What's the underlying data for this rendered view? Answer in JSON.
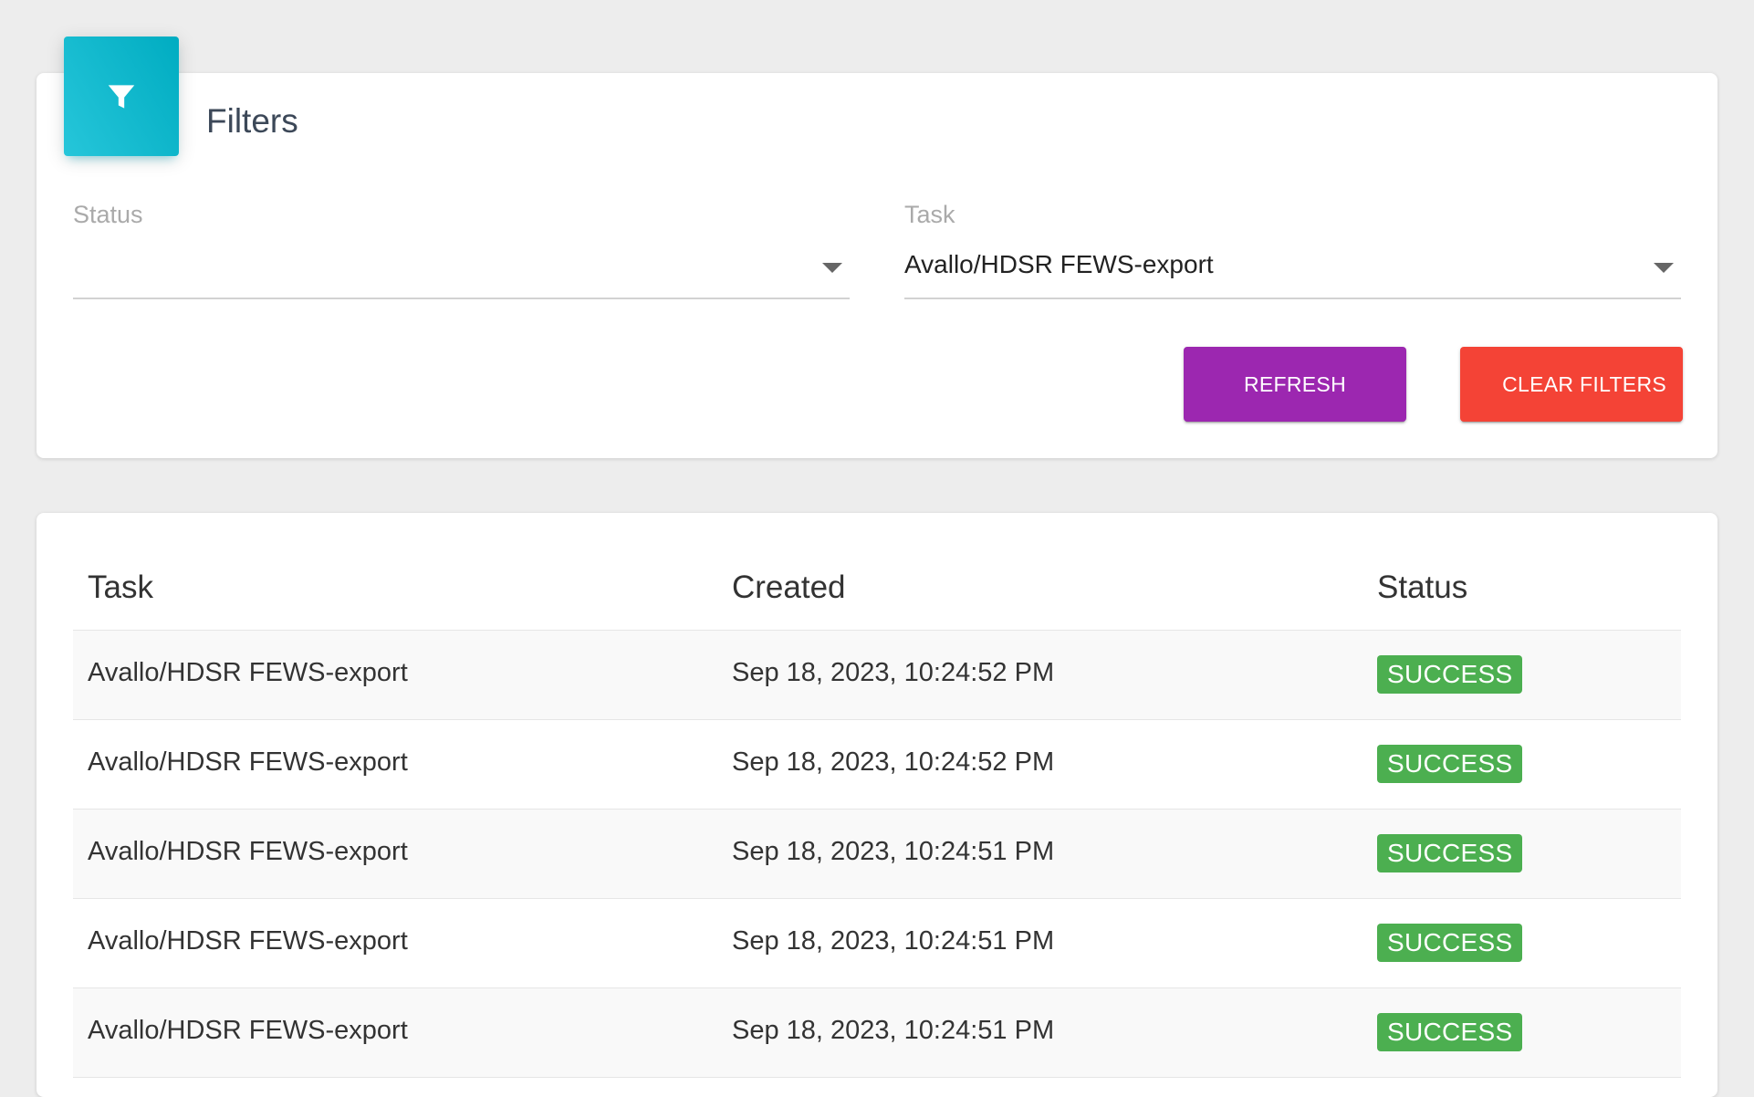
{
  "filters": {
    "title": "Filters",
    "icon": "filter-icon",
    "status_label": "Status",
    "status_value": "",
    "task_label": "Task",
    "task_value": "Avallo/HDSR FEWS-export",
    "refresh_label": "REFRESH",
    "clear_label": "CLEAR FILTERS"
  },
  "table": {
    "headers": {
      "task": "Task",
      "created": "Created",
      "status": "Status"
    },
    "rows": [
      {
        "task": "Avallo/HDSR FEWS-export",
        "created": "Sep 18, 2023, 10:24:52 PM",
        "status": "SUCCESS"
      },
      {
        "task": "Avallo/HDSR FEWS-export",
        "created": "Sep 18, 2023, 10:24:52 PM",
        "status": "SUCCESS"
      },
      {
        "task": "Avallo/HDSR FEWS-export",
        "created": "Sep 18, 2023, 10:24:51 PM",
        "status": "SUCCESS"
      },
      {
        "task": "Avallo/HDSR FEWS-export",
        "created": "Sep 18, 2023, 10:24:51 PM",
        "status": "SUCCESS"
      },
      {
        "task": "Avallo/HDSR FEWS-export",
        "created": "Sep 18, 2023, 10:24:51 PM",
        "status": "SUCCESS"
      }
    ]
  },
  "colors": {
    "filter_badge": "#00acc1",
    "refresh_button": "#9c27b0",
    "clear_button": "#f44336",
    "success_badge": "#4caf50"
  }
}
